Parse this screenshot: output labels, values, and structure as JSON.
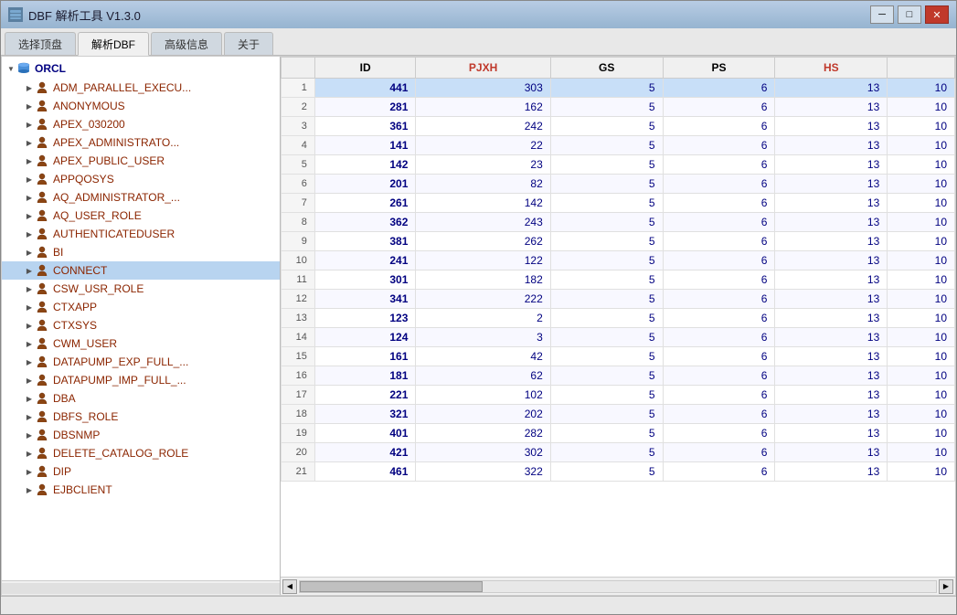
{
  "window": {
    "title": "DBF 解析工具 V1.3.0"
  },
  "tabs": [
    {
      "label": "选择顶盘",
      "active": false
    },
    {
      "label": "解析DBF",
      "active": true
    },
    {
      "label": "高级信息",
      "active": false
    },
    {
      "label": "关于",
      "active": false
    }
  ],
  "tree": {
    "root": "ORCL",
    "items": [
      {
        "label": "ADM_PARALLEL_EXECU...",
        "type": "user",
        "indent": 1
      },
      {
        "label": "ANONYMOUS",
        "type": "user",
        "indent": 1
      },
      {
        "label": "APEX_030200",
        "type": "user",
        "indent": 1
      },
      {
        "label": "APEX_ADMINISTRATO...",
        "type": "user",
        "indent": 1
      },
      {
        "label": "APEX_PUBLIC_USER",
        "type": "user",
        "indent": 1
      },
      {
        "label": "APPQOSYS",
        "type": "user",
        "indent": 1
      },
      {
        "label": "AQ_ADMINISTRATOR_...",
        "type": "user",
        "indent": 1
      },
      {
        "label": "AQ_USER_ROLE",
        "type": "user",
        "indent": 1
      },
      {
        "label": "AUTHENTICATEDUSER",
        "type": "user",
        "indent": 1
      },
      {
        "label": "BI",
        "type": "user",
        "indent": 1
      },
      {
        "label": "CONNECT",
        "type": "user",
        "indent": 1,
        "selected": true
      },
      {
        "label": "CSW_USR_ROLE",
        "type": "user",
        "indent": 1
      },
      {
        "label": "CTXAPP",
        "type": "user",
        "indent": 1
      },
      {
        "label": "CTXSYS",
        "type": "user",
        "indent": 1
      },
      {
        "label": "CWM_USER",
        "type": "user",
        "indent": 1
      },
      {
        "label": "DATAPUMP_EXP_FULL_...",
        "type": "user",
        "indent": 1
      },
      {
        "label": "DATAPUMP_IMP_FULL_...",
        "type": "user",
        "indent": 1
      },
      {
        "label": "DBA",
        "type": "user",
        "indent": 1
      },
      {
        "label": "DBFS_ROLE",
        "type": "user",
        "indent": 1
      },
      {
        "label": "DBSNMP",
        "type": "user",
        "indent": 1
      },
      {
        "label": "DELETE_CATALOG_ROLE",
        "type": "user",
        "indent": 1
      },
      {
        "label": "DIP",
        "type": "user",
        "indent": 1
      },
      {
        "label": "EJBCLIENT",
        "type": "user",
        "indent": 1
      }
    ]
  },
  "table": {
    "columns": [
      {
        "key": "rownum",
        "label": "",
        "type": "rownum"
      },
      {
        "key": "id",
        "label": "ID",
        "type": "id"
      },
      {
        "key": "pjxh",
        "label": "PJXH",
        "type": "red"
      },
      {
        "key": "gs",
        "label": "GS",
        "type": "normal"
      },
      {
        "key": "ps",
        "label": "PS",
        "type": "normal"
      },
      {
        "key": "hs",
        "label": "HS",
        "type": "red"
      }
    ],
    "rows": [
      {
        "rownum": "1",
        "id": "441",
        "pjxh": "303",
        "gs": "5",
        "ps": "6",
        "hs": "13",
        "extra": "10",
        "selected": true
      },
      {
        "rownum": "2",
        "id": "281",
        "pjxh": "162",
        "gs": "5",
        "ps": "6",
        "hs": "13",
        "extra": "10"
      },
      {
        "rownum": "3",
        "id": "361",
        "pjxh": "242",
        "gs": "5",
        "ps": "6",
        "hs": "13",
        "extra": "10"
      },
      {
        "rownum": "4",
        "id": "141",
        "pjxh": "22",
        "gs": "5",
        "ps": "6",
        "hs": "13",
        "extra": "10"
      },
      {
        "rownum": "5",
        "id": "142",
        "pjxh": "23",
        "gs": "5",
        "ps": "6",
        "hs": "13",
        "extra": "10"
      },
      {
        "rownum": "6",
        "id": "201",
        "pjxh": "82",
        "gs": "5",
        "ps": "6",
        "hs": "13",
        "extra": "10"
      },
      {
        "rownum": "7",
        "id": "261",
        "pjxh": "142",
        "gs": "5",
        "ps": "6",
        "hs": "13",
        "extra": "10"
      },
      {
        "rownum": "8",
        "id": "362",
        "pjxh": "243",
        "gs": "5",
        "ps": "6",
        "hs": "13",
        "extra": "10"
      },
      {
        "rownum": "9",
        "id": "381",
        "pjxh": "262",
        "gs": "5",
        "ps": "6",
        "hs": "13",
        "extra": "10"
      },
      {
        "rownum": "10",
        "id": "241",
        "pjxh": "122",
        "gs": "5",
        "ps": "6",
        "hs": "13",
        "extra": "10"
      },
      {
        "rownum": "11",
        "id": "301",
        "pjxh": "182",
        "gs": "5",
        "ps": "6",
        "hs": "13",
        "extra": "10"
      },
      {
        "rownum": "12",
        "id": "341",
        "pjxh": "222",
        "gs": "5",
        "ps": "6",
        "hs": "13",
        "extra": "10"
      },
      {
        "rownum": "13",
        "id": "123",
        "pjxh": "2",
        "gs": "5",
        "ps": "6",
        "hs": "13",
        "extra": "10"
      },
      {
        "rownum": "14",
        "id": "124",
        "pjxh": "3",
        "gs": "5",
        "ps": "6",
        "hs": "13",
        "extra": "10"
      },
      {
        "rownum": "15",
        "id": "161",
        "pjxh": "42",
        "gs": "5",
        "ps": "6",
        "hs": "13",
        "extra": "10"
      },
      {
        "rownum": "16",
        "id": "181",
        "pjxh": "62",
        "gs": "5",
        "ps": "6",
        "hs": "13",
        "extra": "10"
      },
      {
        "rownum": "17",
        "id": "221",
        "pjxh": "102",
        "gs": "5",
        "ps": "6",
        "hs": "13",
        "extra": "10"
      },
      {
        "rownum": "18",
        "id": "321",
        "pjxh": "202",
        "gs": "5",
        "ps": "6",
        "hs": "13",
        "extra": "10"
      },
      {
        "rownum": "19",
        "id": "401",
        "pjxh": "282",
        "gs": "5",
        "ps": "6",
        "hs": "13",
        "extra": "10"
      },
      {
        "rownum": "20",
        "id": "421",
        "pjxh": "302",
        "gs": "5",
        "ps": "6",
        "hs": "13",
        "extra": "10"
      },
      {
        "rownum": "21",
        "id": "461",
        "pjxh": "322",
        "gs": "5",
        "ps": "6",
        "hs": "13",
        "extra": "10"
      }
    ]
  },
  "icons": {
    "minimize": "─",
    "restore": "□",
    "close": "✕",
    "expand_down": "▼",
    "expand_right": "▶",
    "scroll_left": "◀",
    "scroll_right": "▶"
  }
}
